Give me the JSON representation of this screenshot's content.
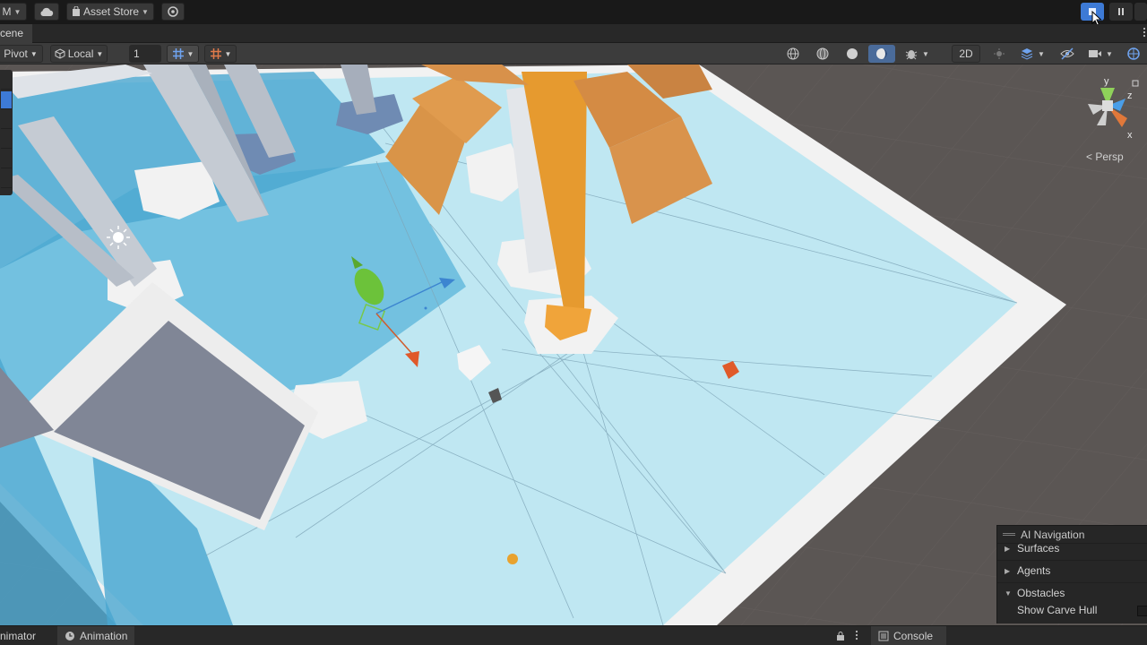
{
  "top_bar": {
    "account_label": "M",
    "asset_store_label": "Asset Store",
    "play_state": "playing"
  },
  "scene_tab": {
    "label": "cene"
  },
  "scene_toolbar": {
    "pivot_label": "Pivot",
    "local_label": "Local",
    "snap_value": "1",
    "mode_2d_label": "2D"
  },
  "viewport": {
    "projection_label": "< Persp",
    "gizmo_axes": {
      "y": "y",
      "x": "x",
      "z": "z"
    }
  },
  "ai_navigation": {
    "title": "AI Navigation",
    "items": [
      {
        "label": "Surfaces",
        "expanded": false
      },
      {
        "label": "Agents",
        "expanded": false
      },
      {
        "label": "Obstacles",
        "expanded": true
      }
    ],
    "option_label": "Show Carve Hull"
  },
  "bottom_tabs": {
    "animator_label": "nimator",
    "animation_label": "Animation",
    "console_label": "Console"
  },
  "colors": {
    "navmesh": "#bfe7f2",
    "ground": "#5b5654",
    "accent": "#3d7ad6",
    "tree": "#e69a2f",
    "agent": "#6cc23a"
  }
}
